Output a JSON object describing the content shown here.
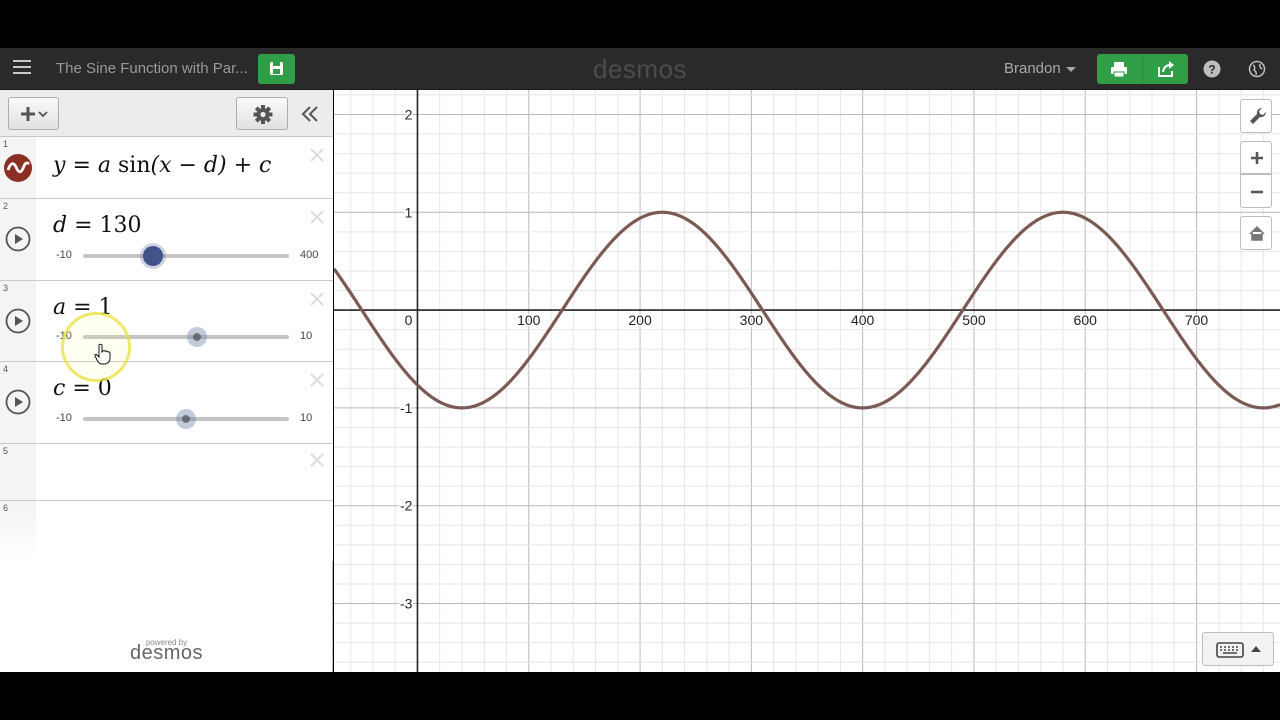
{
  "header": {
    "graph_title": "The Sine Function with Par...",
    "brand": "desmos",
    "user_name": "Brandon"
  },
  "expressions": [
    {
      "index": "1",
      "kind": "equation",
      "latex_parts": [
        "y",
        "=",
        "a",
        "sin",
        "(x − d)",
        "+",
        "c"
      ]
    },
    {
      "index": "2",
      "kind": "slider",
      "variable": "d",
      "value_text": "130",
      "value": 130,
      "min_label": "-10",
      "max_label": "400",
      "min": -10,
      "max": 400
    },
    {
      "index": "3",
      "kind": "slider",
      "variable": "a",
      "value_text": "1",
      "value": 1,
      "min_label": "-10",
      "max_label": "10",
      "min": -10,
      "max": 10
    },
    {
      "index": "4",
      "kind": "slider",
      "variable": "c",
      "value_text": "0",
      "value": 0,
      "min_label": "-10",
      "max_label": "10",
      "min": -10,
      "max": 10
    },
    {
      "index": "5",
      "kind": "empty"
    },
    {
      "index": "6",
      "kind": "empty"
    }
  ],
  "footer": {
    "powered_by": "powered by",
    "logo": "desmos"
  },
  "colors": {
    "accent_green": "#2f9e47",
    "curve": "#7a5a52",
    "slider_knob_active": "#3f5589"
  },
  "icons": {
    "menu": "hamburger-icon",
    "save": "floppy-disk-icon",
    "print": "printer-icon",
    "share": "share-icon",
    "help": "question-circle-icon",
    "language": "globe-icon",
    "add": "plus-icon",
    "settings": "gear-icon",
    "collapse": "double-chevron-left-icon",
    "graph_settings": "wrench-icon",
    "zoom_in": "plus-icon",
    "zoom_out": "minus-icon",
    "home": "home-icon",
    "keyboard": "keyboard-icon"
  },
  "chart_data": {
    "type": "line",
    "title": "",
    "xlabel": "",
    "ylabel": "",
    "xlim": [
      -75,
      775
    ],
    "ylim": [
      -3.7,
      2.25
    ],
    "x_ticks": [
      "0",
      "100",
      "200",
      "300",
      "400",
      "500",
      "600",
      "700"
    ],
    "y_ticks": [
      "2",
      "1",
      "-1",
      "-2",
      "-3"
    ],
    "grid": true,
    "series": [
      {
        "function": "y = a sin(x − d) + c",
        "a": 1,
        "d": 130,
        "c": 0,
        "period_per_x_unit": 0.0174533,
        "angle_mode": "degrees"
      }
    ]
  }
}
